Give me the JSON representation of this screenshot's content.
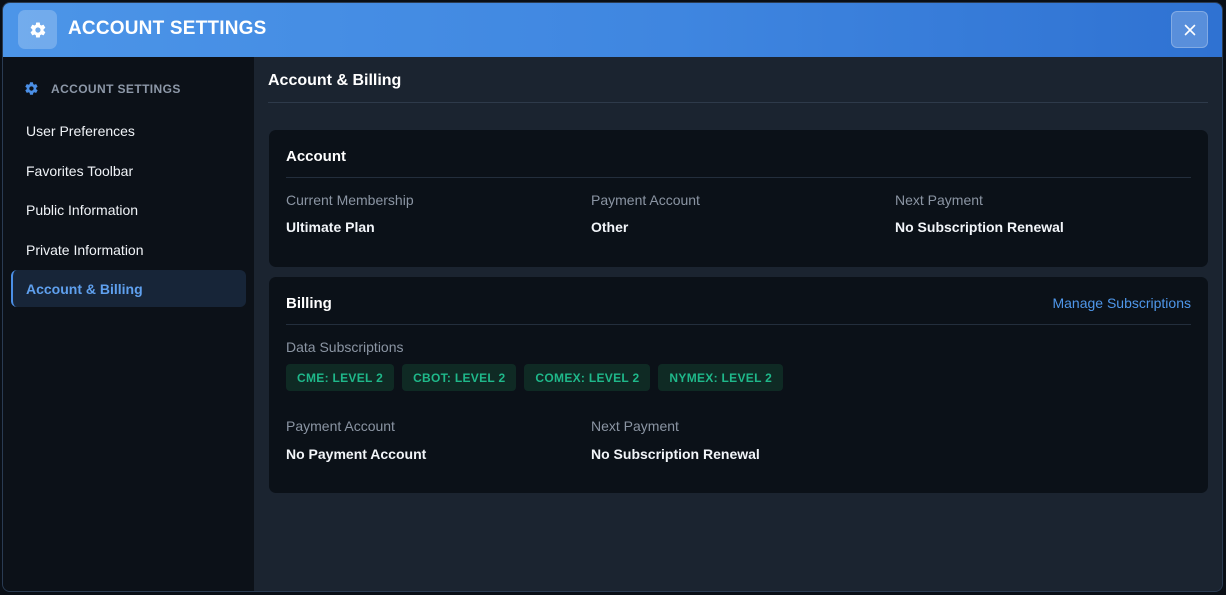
{
  "window": {
    "title": "ACCOUNT SETTINGS",
    "title_icon": "gear-icon",
    "close_icon": "close-icon"
  },
  "sidebar": {
    "header_label": "ACCOUNT SETTINGS",
    "header_icon": "gear-icon",
    "items": [
      {
        "label": "User Preferences",
        "active": false
      },
      {
        "label": "Favorites Toolbar",
        "active": false
      },
      {
        "label": "Public Information",
        "active": false
      },
      {
        "label": "Private Information",
        "active": false
      },
      {
        "label": "Account & Billing",
        "active": true
      }
    ]
  },
  "main": {
    "title": "Account & Billing",
    "account": {
      "title": "Account",
      "fields": [
        {
          "label": "Current Membership",
          "value": "Ultimate Plan"
        },
        {
          "label": "Payment Account",
          "value": "Other"
        },
        {
          "label": "Next Payment",
          "value": "No Subscription Renewal"
        }
      ]
    },
    "billing": {
      "title": "Billing",
      "manage_link": "Manage Subscriptions",
      "subscriptions_label": "Data Subscriptions",
      "subscriptions": [
        "CME: LEVEL 2",
        "CBOT: LEVEL 2",
        "COMEX: LEVEL 2",
        "NYMEX: LEVEL 2"
      ],
      "fields": [
        {
          "label": "Payment Account",
          "value": "No Payment Account"
        },
        {
          "label": "Next Payment",
          "value": "No Subscription Renewal"
        }
      ]
    }
  },
  "colors": {
    "accent": "#4f97ea",
    "badge_text": "#1fb88a",
    "badge_bg": "#0f2a24",
    "sidebar_bg": "#0c1118",
    "card_bg": "#0b1118"
  }
}
